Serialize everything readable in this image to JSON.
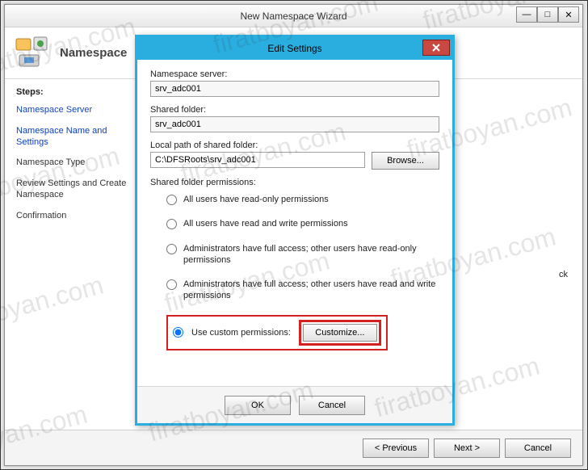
{
  "wizard": {
    "title": "New Namespace Wizard",
    "header_title": "Namespace",
    "steps_title": "Steps:",
    "steps": [
      {
        "label": "Namespace Server",
        "state": "link"
      },
      {
        "label": "Namespace Name and Settings",
        "state": "active"
      },
      {
        "label": "Namespace Type",
        "state": ""
      },
      {
        "label": "Review Settings and Create Namespace",
        "state": ""
      },
      {
        "label": "Confirmation",
        "state": ""
      }
    ],
    "buttons": {
      "previous": "< Previous",
      "next": "Next >",
      "cancel": "Cancel"
    }
  },
  "dialog": {
    "title": "Edit Settings",
    "labels": {
      "ns_server": "Namespace server:",
      "shared_folder": "Shared folder:",
      "local_path": "Local path of shared folder:",
      "permissions": "Shared folder permissions:"
    },
    "values": {
      "ns_server": "srv_adc001",
      "shared_folder": "srv_adc001",
      "local_path": "C:\\DFSRoots\\srv_adc001"
    },
    "browse": "Browse...",
    "radios": {
      "r1": "All users have read-only permissions",
      "r2": "All users have read and write permissions",
      "r3": "Administrators have full access; other users have read-only permissions",
      "r4": "Administrators have full access; other users have read and write permissions",
      "r5": "Use custom permissions:"
    },
    "customize": "Customize...",
    "ok": "OK",
    "cancel": "Cancel"
  },
  "hidden_check_text": "ck",
  "watermark": "firatboyan.com"
}
